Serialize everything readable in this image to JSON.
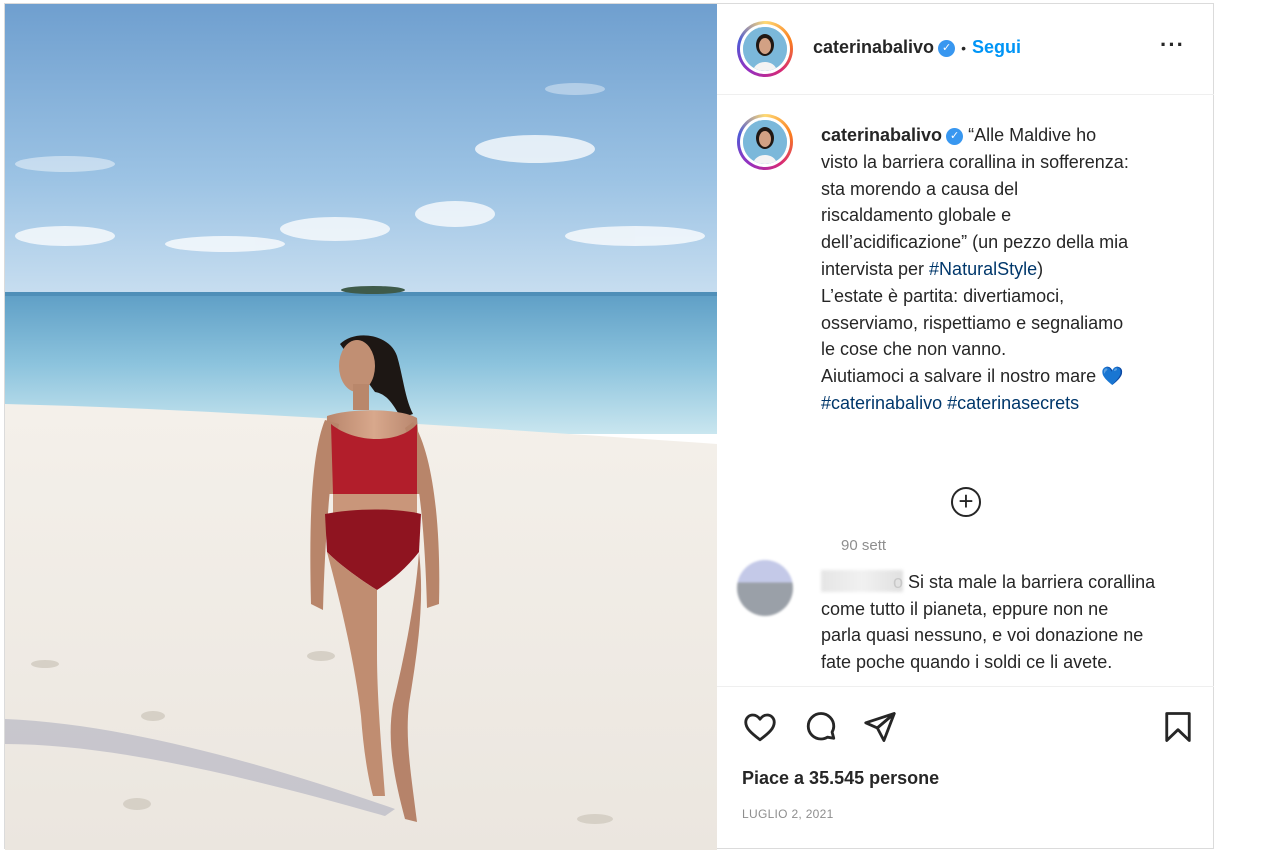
{
  "post": {
    "username": "caterinabalivo",
    "verified_badge": "✓",
    "separator": "•",
    "follow_label": "Segui",
    "more_label": "···",
    "caption": {
      "lines": [
        "“Alle Maldive ho",
        "visto la barriera corallina in sofferenza:",
        "sta morendo a causa del",
        "riscaldamento globale e",
        "dell’acidificazione” (un pezzo della mia",
        "intervista per ",
        "L’estate è partita: divertiamoci,",
        "osserviamo, rispettiamo e segnaliamo",
        "le cose che non vanno.",
        "Aiutiamoci a salvare il nostro mare "
      ],
      "hashtag_natural": "#NaturalStyle",
      "hashtag_close": ")",
      "hashtag_caterina": "#caterinabalivo",
      "hashtag_secrets": "#caterinasecrets",
      "emoji_heart": "💙",
      "time": "90 sett"
    },
    "load_more_label": "+",
    "comment": {
      "name_fragment": "o",
      "lines": [
        " Si sta male la barriera corallina",
        "come tutto il pianeta, eppure non ne",
        "parla quasi nessuno, e voi donazione ne",
        "fate poche quando i soldi ce li avete."
      ]
    },
    "likes": "Piace a 35.545 persone",
    "date": "LUGLIO 2, 2021"
  },
  "icons": {
    "like": "heart-icon",
    "comment": "comment-icon",
    "share": "share-icon",
    "save": "bookmark-icon",
    "more": "more-icon",
    "add": "plus-circle-icon"
  },
  "colors": {
    "link": "#0095f6",
    "hashtag": "#00376b",
    "verified": "#3897f0",
    "muted": "#8e8e8e"
  }
}
